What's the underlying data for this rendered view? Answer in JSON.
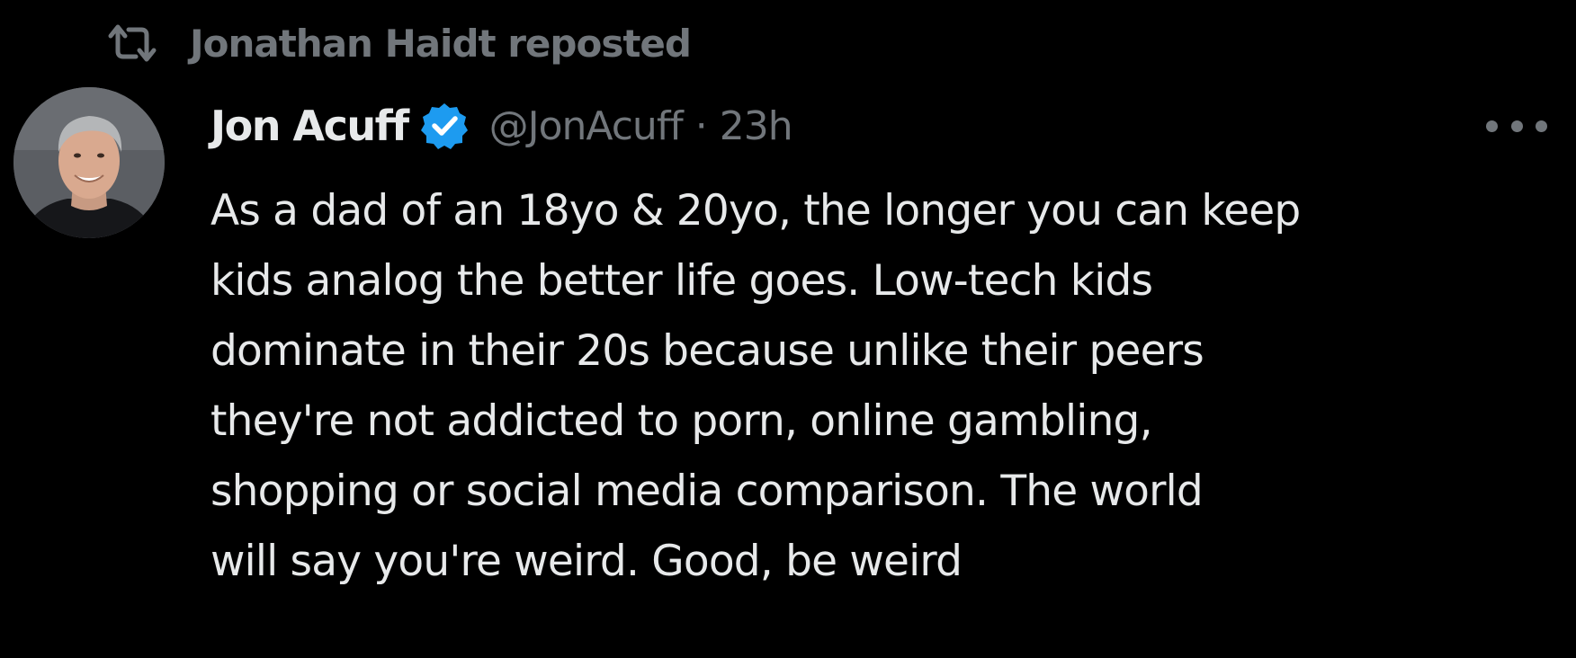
{
  "repost": {
    "icon": "repost-icon",
    "label": "Jonathan Haidt reposted"
  },
  "author": {
    "display_name": "Jon Acuff",
    "verified_icon": "verified-badge-icon",
    "handle": "@JonAcuff",
    "separator": "·",
    "timestamp": "23h"
  },
  "more_menu_icon": "more-options-icon",
  "tweet": {
    "lines": [
      "As a dad of an 18yo & 20yo, the longer you can keep",
      "kids analog the better life goes. Low-tech kids",
      "dominate in their 20s because unlike their peers",
      "they're not addicted to porn, online gambling,",
      "shopping or social media comparison. The world",
      "will say you're weird. Good, be weird"
    ]
  },
  "colors": {
    "background": "#000000",
    "primary_text": "#e7e9ea",
    "secondary_text": "#71767b",
    "verified_blue": "#1d9bf0"
  }
}
